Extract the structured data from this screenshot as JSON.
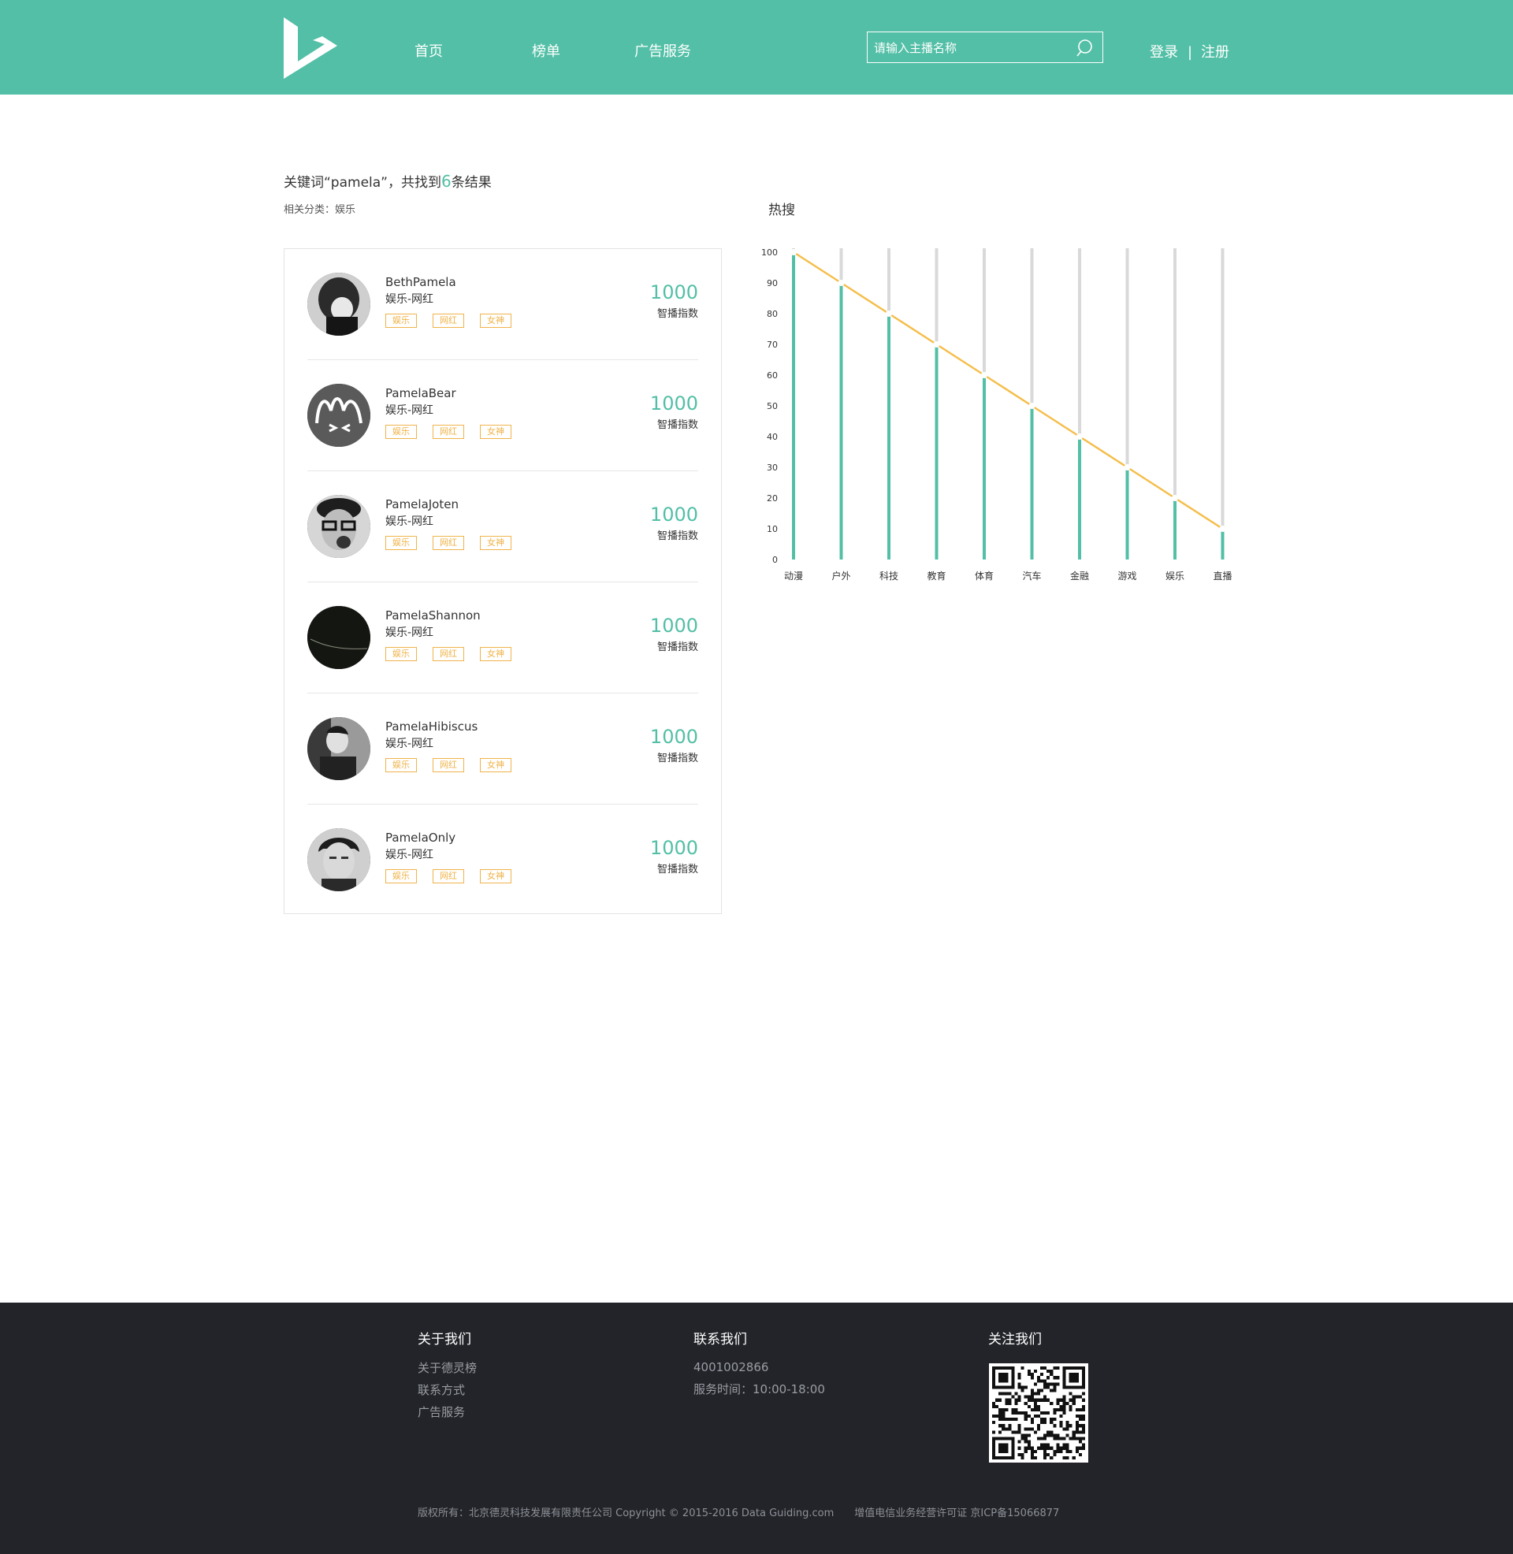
{
  "header": {
    "nav": [
      "首页",
      "榜单",
      "广告服务"
    ],
    "search_placeholder": "请输入主播名称",
    "login": "登录",
    "separator": "|",
    "register": "注册"
  },
  "search_result": {
    "prefix": "关键词“pamela”，共找到",
    "count": "6",
    "suffix": "条结果",
    "related_category": "相关分类：娱乐"
  },
  "results": [
    {
      "name": "BethPamela",
      "category": "娱乐-网红",
      "tags": [
        "娱乐",
        "网红",
        "女神"
      ],
      "score": "1000",
      "score_label": "智播指数"
    },
    {
      "name": "PamelaBear",
      "category": "娱乐-网红",
      "tags": [
        "娱乐",
        "网红",
        "女神"
      ],
      "score": "1000",
      "score_label": "智播指数"
    },
    {
      "name": "PamelaJoten",
      "category": "娱乐-网红",
      "tags": [
        "娱乐",
        "网红",
        "女神"
      ],
      "score": "1000",
      "score_label": "智播指数"
    },
    {
      "name": "PamelaShannon",
      "category": "娱乐-网红",
      "tags": [
        "娱乐",
        "网红",
        "女神"
      ],
      "score": "1000",
      "score_label": "智播指数"
    },
    {
      "name": "PamelaHibiscus",
      "category": "娱乐-网红",
      "tags": [
        "娱乐",
        "网红",
        "女神"
      ],
      "score": "1000",
      "score_label": "智播指数"
    },
    {
      "name": "PamelaOnly",
      "category": "娱乐-网红",
      "tags": [
        "娱乐",
        "网红",
        "女神"
      ],
      "score": "1000",
      "score_label": "智播指数"
    }
  ],
  "chart_data": {
    "type": "bar",
    "title": "热搜",
    "categories": [
      "动漫",
      "户外",
      "科技",
      "教育",
      "体育",
      "汽车",
      "金融",
      "游戏",
      "娱乐",
      "直播"
    ],
    "values": [
      100,
      90,
      80,
      70,
      60,
      50,
      40,
      30,
      20,
      10
    ],
    "ylim": [
      0,
      100
    ],
    "yticks": [
      0,
      10,
      20,
      30,
      40,
      50,
      60,
      70,
      80,
      90,
      100
    ],
    "grid": false,
    "colors": {
      "bar": "#52bfa6",
      "track": "#d9d9d9",
      "line": "#f5be4b"
    }
  },
  "footer": {
    "about_title": "关于我们",
    "about_links": [
      "关于德灵榜",
      "联系方式",
      "广告服务"
    ],
    "contact_title": "联系我们",
    "phone": "4001002866",
    "hours": "服务时间：10:00-18:00",
    "follow_title": "关注我们",
    "copyright": "版权所有：北京德灵科技发展有限责任公司 Copyright © 2015-2016 Data Guiding.com　　增值电信业务经营许可证 京ICP备15066877"
  },
  "colors": {
    "brand": "#52bfa6",
    "tag": "#f0b34a",
    "footer_bg": "#222429"
  }
}
